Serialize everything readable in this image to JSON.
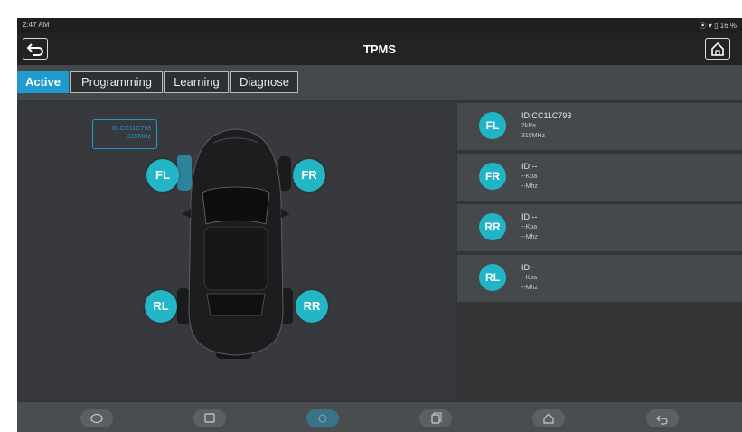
{
  "status_bar": {
    "time": "2:47 AM",
    "indicators": "16 %"
  },
  "header": {
    "title": "TPMS",
    "back_icon": "back-arrow-icon",
    "home_icon": "home-icon"
  },
  "tabs": [
    {
      "label": "Active",
      "selected": true
    },
    {
      "label": "Programming",
      "selected": false
    },
    {
      "label": "Learning",
      "selected": false
    },
    {
      "label": "Diagnose",
      "selected": false
    }
  ],
  "vehicle": {
    "id_box": {
      "line1": "ID:CC11C793",
      "line2": "315MHz"
    },
    "wheels": {
      "fl": "FL",
      "fr": "FR",
      "rl": "RL",
      "rr": "RR"
    }
  },
  "sensors": [
    {
      "position": "FL",
      "id": "ID:CC11C793",
      "pressure": "2kPa",
      "frequency": "315MHz"
    },
    {
      "position": "FR",
      "id": "ID:--",
      "pressure": "--Kpa",
      "frequency": "--Mhz"
    },
    {
      "position": "RR",
      "id": "ID:--",
      "pressure": "--Kpa",
      "frequency": "--Mhz"
    },
    {
      "position": "RL",
      "id": "ID:--",
      "pressure": "--Kpa",
      "frequency": "--Mhz"
    }
  ],
  "nav": [
    "chat-icon",
    "gallery-icon",
    "vehicle-icon",
    "recent-apps-icon",
    "home-icon",
    "back-icon"
  ],
  "colors": {
    "accent": "#1f9bd0",
    "badge": "#20b4c6"
  }
}
